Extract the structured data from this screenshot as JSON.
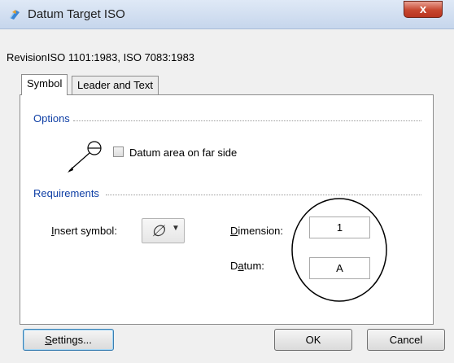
{
  "window": {
    "title": "Datum Target ISO",
    "close_glyph": "x",
    "app_icon": "datum-target-icon"
  },
  "revision": "RevisionISO 1101:1983, ISO 7083:1983",
  "tabs": [
    {
      "label": "Symbol",
      "active": true
    },
    {
      "label": "Leader and Text",
      "active": false
    }
  ],
  "options": {
    "heading": "Options",
    "far_side_checkbox": {
      "label": "Datum area on far side",
      "checked": false
    }
  },
  "requirements": {
    "heading": "Requirements",
    "insert_symbol": {
      "label_mnemonic": "I",
      "label_rest": "nsert symbol:",
      "value": "∅"
    },
    "dimension": {
      "label_mnemonic": "D",
      "label_rest": "imension:",
      "value": "1"
    },
    "datum": {
      "label_pre": "D",
      "label_mnemonic": "a",
      "label_rest": "tum:",
      "value": "A"
    }
  },
  "buttons": {
    "settings": {
      "mnemonic": "S",
      "rest": "ettings..."
    },
    "ok": "OK",
    "cancel": "Cancel"
  },
  "colors": {
    "section_heading": "#0f3fa5",
    "close_button": "#c7472f"
  }
}
